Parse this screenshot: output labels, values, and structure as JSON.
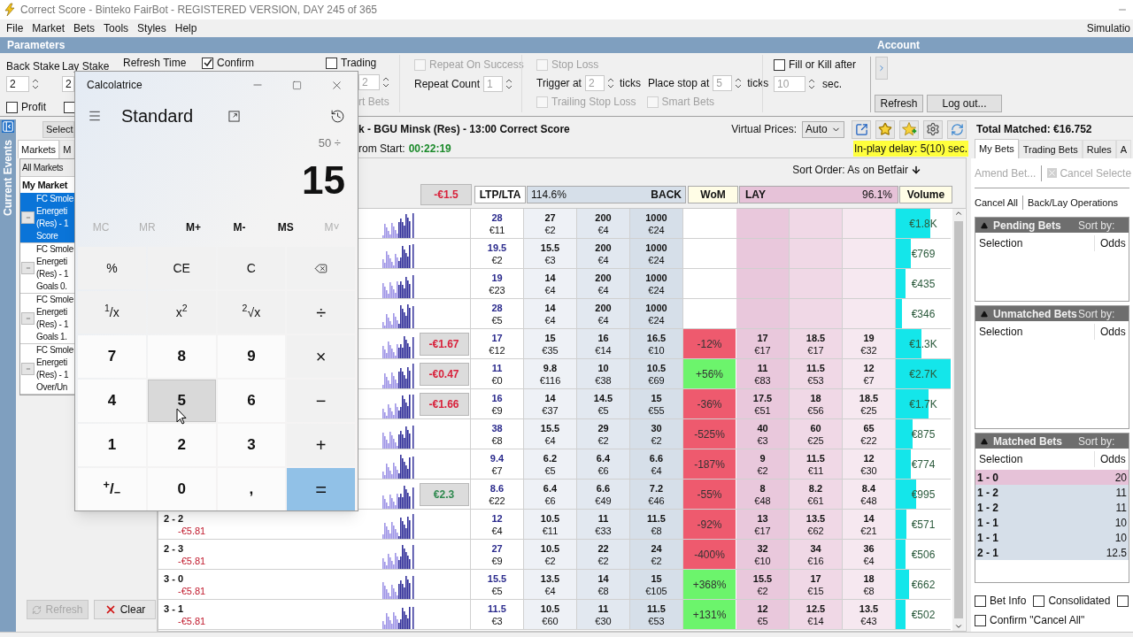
{
  "window": {
    "title": "Correct Score - Binteko FairBot - REGISTERED VERSION, DAY 245 of 365"
  },
  "menu": [
    "File",
    "Market",
    "Bets",
    "Tools",
    "Styles",
    "Help"
  ],
  "mode_indicator": "Simulatio",
  "parameters": {
    "title": "Parameters",
    "account_title": "Account",
    "back_stake": {
      "label": "Back Stake",
      "value": "2"
    },
    "lay_stake": {
      "label": "Lay Stake",
      "value": "2"
    },
    "profit": {
      "label": "Profit",
      "checked": false
    },
    "checkbox_2": {
      "checked": false
    },
    "refresh_time": {
      "label": "Refresh Time"
    },
    "confirm": {
      "label": "Confirm",
      "checked": true
    },
    "trading": {
      "label": "Trading",
      "checked": false
    },
    "trading_value": {
      "value": "2",
      "disabled": true
    },
    "smart_bets_cut": "rt Bets",
    "repeat_on_success": {
      "label": "Repeat On Success",
      "checked": false,
      "disabled": true
    },
    "repeat_count": {
      "label": "Repeat Count",
      "value": "1",
      "disabled": true
    },
    "stop_loss": {
      "label": "Stop Loss",
      "checked": false,
      "disabled": true
    },
    "trigger": {
      "label": "Trigger at",
      "value": "2",
      "unit": "ticks",
      "disabled": true
    },
    "place_stop": {
      "label": "Place stop at",
      "value": "5",
      "unit": "ticks",
      "disabled": true
    },
    "trailing_stop_loss": {
      "label": "Trailing Stop Loss",
      "checked": false,
      "disabled": true
    },
    "smart_bets": {
      "label": "Smart Bets",
      "checked": false,
      "disabled": true
    },
    "fill_or_kill": {
      "label": "Fill or Kill after",
      "checked": false
    },
    "fill_or_kill_seconds": {
      "value": "10",
      "unit": "sec.",
      "disabled": true
    },
    "buttons": [
      "Refresh",
      "Log out..."
    ]
  },
  "left_rail": {
    "title": "Current Events"
  },
  "left_panel": {
    "select_button": "Select",
    "tabs": [
      {
        "label": "Markets",
        "selected": true
      },
      {
        "label": "M",
        "selected": false
      }
    ],
    "list_header": "All Markets",
    "group": "My Market",
    "markets": [
      {
        "text": "FC Smole\nEnergeti\n(Res) - 1\nScore",
        "selected": true
      },
      {
        "text": "FC Smole\nEnergeti\n(Res) - 1\nGoals 0.",
        "selected": false
      },
      {
        "text": "FC Smole\nEnergeti\n(Res) - 1\nGoals 1.",
        "selected": false
      },
      {
        "text": "FC Smole\nEnergeti\n(Res) - 1\nOver/Un",
        "selected": false
      }
    ],
    "buttons": [
      {
        "label": "Refresh",
        "disabled": true
      },
      {
        "label": "Clear",
        "disabled": false
      }
    ]
  },
  "center": {
    "event_title": "k - BGU Minsk (Res) - 13:00 Correct Score",
    "time_label": "rom Start:",
    "time_value": "00:22:19",
    "virtual_prices_label": "Virtual Prices:",
    "virtual_prices_value": "Auto",
    "inplay_delay": "In-play delay: 5(10) sec.",
    "sort_order": "Sort Order: As on Betfair",
    "header": {
      "pnl": "-€1.5",
      "ltp": "LTP/LTA",
      "back_percent": "114.6%",
      "back": "BACK",
      "wom": "WoM",
      "lay": "LAY",
      "lay_percent": "96.1%",
      "volume": "Volume"
    },
    "rows": [
      {
        "ltp": [
          "28",
          "€11"
        ],
        "back": [
          [
            "27",
            "€2"
          ],
          [
            "200",
            "€4"
          ],
          [
            "1000",
            "€24"
          ]
        ],
        "volume": {
          "text": "€1.8K",
          "level": 0.63
        }
      },
      {
        "ltp": [
          "19.5",
          "€2"
        ],
        "back": [
          [
            "15.5",
            "€3"
          ],
          [
            "200",
            "€4"
          ],
          [
            "1000",
            "€24"
          ]
        ],
        "volume": {
          "text": "€769",
          "level": 0.27
        }
      },
      {
        "ltp": [
          "19",
          "€23"
        ],
        "back": [
          [
            "14",
            "€4"
          ],
          [
            "200",
            "€4"
          ],
          [
            "1000",
            "€24"
          ]
        ],
        "volume": {
          "text": "€435",
          "level": 0.17
        }
      },
      {
        "ltp": [
          "28",
          "€5"
        ],
        "back": [
          [
            "14",
            "€4"
          ],
          [
            "200",
            "€4"
          ],
          [
            "1000",
            "€24"
          ]
        ],
        "volume": {
          "text": "€346",
          "level": 0.12
        }
      },
      {
        "pnl_box": {
          "text": "-€1.67",
          "positive": false
        },
        "ltp": [
          "17",
          "€12"
        ],
        "back": [
          [
            "15",
            "€35"
          ],
          [
            "16",
            "€14"
          ],
          [
            "16.5",
            "€10"
          ]
        ],
        "wom": {
          "text": "-12%",
          "positive": false
        },
        "lay": [
          [
            "17",
            "€17"
          ],
          [
            "18.5",
            "€17"
          ],
          [
            "19",
            "€32"
          ]
        ],
        "volume": {
          "text": "€1.3K",
          "level": 0.47
        }
      },
      {
        "pnl_box": {
          "text": "-€0.47",
          "positive": false
        },
        "ltp": [
          "11",
          "€0"
        ],
        "back": [
          [
            "9.8",
            "€116"
          ],
          [
            "10",
            "€38"
          ],
          [
            "10.5",
            "€69"
          ]
        ],
        "wom": {
          "text": "+56%",
          "positive": true
        },
        "lay": [
          [
            "11",
            "€83"
          ],
          [
            "11.5",
            "€53"
          ],
          [
            "12",
            "€7"
          ]
        ],
        "volume": {
          "text": "€2.7K",
          "level": 1
        }
      },
      {
        "pnl_box": {
          "text": "-€1.66",
          "positive": false
        },
        "ltp": [
          "16",
          "€9"
        ],
        "back": [
          [
            "14",
            "€37"
          ],
          [
            "14.5",
            "€5"
          ],
          [
            "15",
            "€55"
          ]
        ],
        "wom": {
          "text": "-36%",
          "positive": false
        },
        "lay": [
          [
            "17.5",
            "€51"
          ],
          [
            "18",
            "€56"
          ],
          [
            "18.5",
            "€25"
          ]
        ],
        "volume": {
          "text": "€1.7K",
          "level": 0.6
        }
      },
      {
        "ltp": [
          "38",
          "€8"
        ],
        "back": [
          [
            "15.5",
            "€4"
          ],
          [
            "29",
            "€2"
          ],
          [
            "30",
            "€2"
          ]
        ],
        "wom": {
          "text": "-525%",
          "positive": false
        },
        "lay": [
          [
            "40",
            "€3"
          ],
          [
            "60",
            "€25"
          ],
          [
            "65",
            "€22"
          ]
        ],
        "volume": {
          "text": "€875",
          "level": 0.3
        }
      },
      {
        "ltp": [
          "9.4",
          "€7"
        ],
        "back": [
          [
            "6.2",
            "€5"
          ],
          [
            "6.4",
            "€6"
          ],
          [
            "6.6",
            "€4"
          ]
        ],
        "wom": {
          "text": "-187%",
          "positive": false
        },
        "lay": [
          [
            "9",
            "€2"
          ],
          [
            "11.5",
            "€11"
          ],
          [
            "12",
            "€30"
          ]
        ],
        "volume": {
          "text": "€774",
          "level": 0.27
        }
      },
      {
        "pnl_box": {
          "text": "€2.3",
          "positive": true
        },
        "ltp": [
          "8.6",
          "€22"
        ],
        "back": [
          [
            "6.4",
            "€6"
          ],
          [
            "6.6",
            "€49"
          ],
          [
            "7.2",
            "€46"
          ]
        ],
        "wom": {
          "text": "-55%",
          "positive": false
        },
        "lay": [
          [
            "8",
            "€48"
          ],
          [
            "8.2",
            "€61"
          ],
          [
            "8.4",
            "€48"
          ]
        ],
        "volume": {
          "text": "€995",
          "level": 0.37
        }
      },
      {
        "name": "2 - 2",
        "pl": "-€5.81",
        "ltp": [
          "12",
          "€4"
        ],
        "back": [
          [
            "10.5",
            "€11"
          ],
          [
            "11",
            "€33"
          ],
          [
            "11.5",
            "€8"
          ]
        ],
        "wom": {
          "text": "-92%",
          "positive": false
        },
        "lay": [
          [
            "13",
            "€17"
          ],
          [
            "13.5",
            "€62"
          ],
          [
            "14",
            "€21"
          ]
        ],
        "volume": {
          "text": "€571",
          "level": 0.2
        }
      },
      {
        "name": "2 - 3",
        "pl": "-€5.81",
        "ltp": [
          "27",
          "€9"
        ],
        "back": [
          [
            "10.5",
            "€2"
          ],
          [
            "22",
            "€2"
          ],
          [
            "24",
            "€2"
          ]
        ],
        "wom": {
          "text": "-400%",
          "positive": false
        },
        "lay": [
          [
            "32",
            "€10"
          ],
          [
            "34",
            "€16"
          ],
          [
            "36",
            "€4"
          ]
        ],
        "volume": {
          "text": "€506",
          "level": 0.18
        }
      },
      {
        "name": "3 - 0",
        "pl": "-€5.81",
        "ltp": [
          "15.5",
          "€5"
        ],
        "back": [
          [
            "13.5",
            "€4"
          ],
          [
            "14",
            "€8"
          ],
          [
            "15",
            "€105"
          ]
        ],
        "wom": {
          "text": "+368%",
          "positive": true
        },
        "lay": [
          [
            "15.5",
            "€2"
          ],
          [
            "17",
            "€15"
          ],
          [
            "18",
            "€8"
          ]
        ],
        "volume": {
          "text": "€662",
          "level": 0.24
        }
      },
      {
        "name": "3 - 1",
        "pl": "-€5.81",
        "ltp": [
          "11.5",
          "€3"
        ],
        "back": [
          [
            "10.5",
            "€60"
          ],
          [
            "11",
            "€30"
          ],
          [
            "11.5",
            "€53"
          ]
        ],
        "wom": {
          "text": "+131%",
          "positive": true
        },
        "lay": [
          [
            "12",
            "€5"
          ],
          [
            "12.5",
            "€14"
          ],
          [
            "13.5",
            "€43"
          ]
        ],
        "volume": {
          "text": "€502",
          "level": 0.17
        }
      }
    ]
  },
  "right_panel": {
    "total_matched": "Total Matched: €16.752",
    "tabs": [
      {
        "label": "My Bets",
        "selected": true
      },
      {
        "label": "Trading Bets",
        "selected": false
      },
      {
        "label": "Rules",
        "selected": false
      },
      {
        "label": "A",
        "selected": false
      }
    ],
    "amend_button": {
      "label": "Amend Bet...",
      "disabled": true
    },
    "cancel_selected_button": {
      "label": "Cancel Selecte",
      "disabled": true
    },
    "cancel_all_button": "Cancel All",
    "back_lay_button": "Back/Lay Operations",
    "sections": [
      {
        "title": "Pending Bets",
        "sort_label": "Sort by:",
        "columns": [
          "Selection",
          "Odds"
        ]
      },
      {
        "title": "Unmatched Bets",
        "sort_label": "Sort by:",
        "columns": [
          "Selection",
          "Odds"
        ]
      },
      {
        "title": "Matched Bets",
        "sort_label": "Sort by:",
        "columns": [
          "Selection",
          "Odds"
        ],
        "rows": [
          {
            "selection": "1 - 0",
            "odds": "20",
            "lay": true
          },
          {
            "selection": "1 - 2",
            "odds": "11",
            "lay": false
          },
          {
            "selection": "1 - 2",
            "odds": "11",
            "lay": false
          },
          {
            "selection": "1 - 1",
            "odds": "10",
            "lay": false
          },
          {
            "selection": "1 - 1",
            "odds": "10",
            "lay": false
          },
          {
            "selection": "2 - 1",
            "odds": "12.5",
            "lay": false
          }
        ]
      }
    ],
    "options": [
      {
        "label": "Bet Info",
        "checked": false
      },
      {
        "label": "Consolidated",
        "checked": false
      },
      {
        "checked": false
      },
      {
        "label": "Confirm \"Cancel All\"",
        "checked": false
      }
    ]
  },
  "calculator": {
    "title": "Calcolatrice",
    "mode": "Standard",
    "expression": "50 ÷",
    "display": "15",
    "memory": [
      {
        "label": "MC",
        "disabled": true
      },
      {
        "label": "MR",
        "disabled": true
      },
      {
        "label": "M+",
        "disabled": false
      },
      {
        "label": "M-",
        "disabled": false
      },
      {
        "label": "MS",
        "disabled": false
      },
      {
        "label": "M˅",
        "disabled": true
      }
    ],
    "keys": [
      {
        "label": "%",
        "kind": "function",
        "hovered": false
      },
      {
        "label": "CE",
        "kind": "function",
        "hovered": false
      },
      {
        "label": "C",
        "kind": "function",
        "hovered": false
      },
      {
        "kind": "backspace",
        "hovered": false
      },
      {
        "label": "$^{1}$/x",
        "kind": "function",
        "hovered": false
      },
      {
        "label": "x$^{2}$",
        "kind": "function",
        "hovered": false
      },
      {
        "label": "$^{2}$√x",
        "kind": "function",
        "hovered": false
      },
      {
        "label": "÷",
        "kind": "operator",
        "hovered": false
      },
      {
        "label": "7",
        "kind": "digit",
        "hovered": false
      },
      {
        "label": "8",
        "kind": "digit",
        "hovered": false
      },
      {
        "label": "9",
        "kind": "digit",
        "hovered": false
      },
      {
        "label": "×",
        "kind": "operator",
        "hovered": false
      },
      {
        "label": "4",
        "kind": "digit",
        "hovered": false
      },
      {
        "label": "5",
        "kind": "digit",
        "hovered": true
      },
      {
        "label": "6",
        "kind": "digit",
        "hovered": false
      },
      {
        "label": "−",
        "kind": "operator",
        "hovered": false
      },
      {
        "label": "1",
        "kind": "digit",
        "hovered": false
      },
      {
        "label": "2",
        "kind": "digit",
        "hovered": false
      },
      {
        "label": "3",
        "kind": "digit",
        "hovered": false
      },
      {
        "label": "+",
        "kind": "operator",
        "hovered": false
      },
      {
        "label": "$^{+}$/$_{−}$",
        "kind": "digit",
        "hovered": false
      },
      {
        "label": "0",
        "kind": "digit",
        "hovered": false
      },
      {
        "label": ",",
        "kind": "digit",
        "hovered": false
      },
      {
        "label": "=",
        "kind": "equals",
        "hovered": false
      }
    ]
  }
}
